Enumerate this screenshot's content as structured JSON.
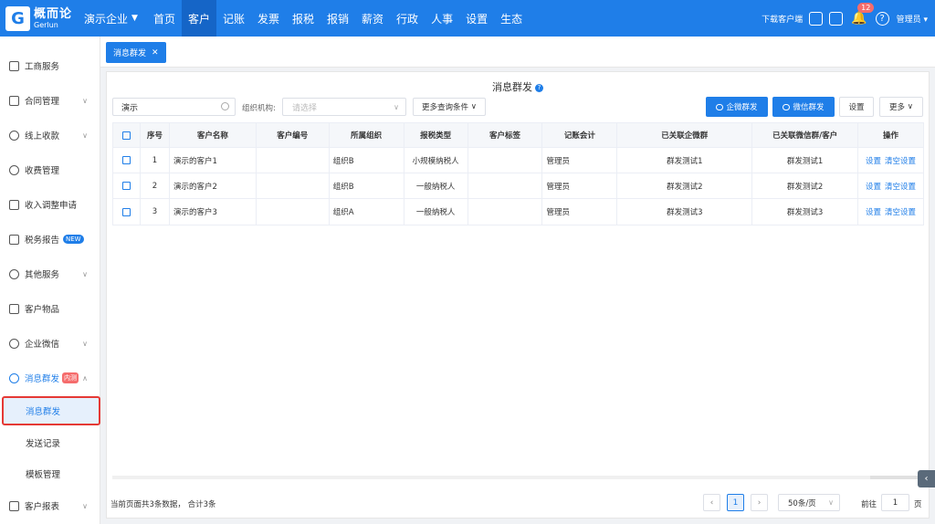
{
  "brand": {
    "cn": "概而论",
    "en": "Gerlun",
    "mark": "G"
  },
  "company": "演示企业",
  "nav": [
    "首页",
    "客户",
    "记账",
    "发票",
    "报税",
    "报销",
    "薪资",
    "行政",
    "人事",
    "设置",
    "生态"
  ],
  "nav_active": "客户",
  "top_right": {
    "download": "下载客户端",
    "badge_count": "12",
    "user": "管理员"
  },
  "sidebar": {
    "items": [
      {
        "label": "工商服务"
      },
      {
        "label": "合同管理"
      },
      {
        "label": "线上收款"
      },
      {
        "label": "收费管理"
      },
      {
        "label": "收入调整申请"
      },
      {
        "label": "税务报告",
        "badge": "NEW"
      },
      {
        "label": "其他服务"
      },
      {
        "label": "客户物品"
      },
      {
        "label": "企业微信"
      },
      {
        "label": "消息群发",
        "badge": "内测"
      }
    ],
    "sub_items": [
      {
        "label": "消息群发"
      },
      {
        "label": "发送记录"
      },
      {
        "label": "模板管理"
      }
    ],
    "last_item": {
      "label": "客户报表"
    }
  },
  "tab": {
    "label": "消息群发"
  },
  "page": {
    "title": "消息群发"
  },
  "filters": {
    "search_value": "演示",
    "org_label": "组织机构:",
    "org_placeholder": "请选择",
    "more_conditions": "更多查询条件"
  },
  "actions": {
    "enterprise_group_send": "企微群发",
    "wechat_group_send": "微信群发",
    "settings": "设置",
    "more": "更多"
  },
  "table": {
    "headers": [
      "序号",
      "客户名称",
      "客户编号",
      "所属组织",
      "报税类型",
      "客户标签",
      "记账会计",
      "已关联企微群",
      "已关联微信群/客户",
      "操作"
    ],
    "rows": [
      {
        "no": "1",
        "name": "演示的客户1",
        "code": "",
        "org": "组织B",
        "tax": "小规模纳税人",
        "tag": "",
        "accountant": "管理员",
        "wecom": "群发测试1",
        "wechat": "群发测试1"
      },
      {
        "no": "2",
        "name": "演示的客户2",
        "code": "",
        "org": "组织B",
        "tax": "一般纳税人",
        "tag": "",
        "accountant": "管理员",
        "wecom": "群发测试2",
        "wechat": "群发测试2"
      },
      {
        "no": "3",
        "name": "演示的客户3",
        "code": "",
        "org": "组织A",
        "tax": "一般纳税人",
        "tag": "",
        "accountant": "管理员",
        "wecom": "群发测试3",
        "wechat": "群发测试3"
      }
    ],
    "row_actions": {
      "set": "设置",
      "clear": "清空设置"
    }
  },
  "footer": {
    "info": "当前页面共3条数据， 合计3条",
    "current_page": "1",
    "page_size": "50条/页",
    "goto_label": "前往",
    "goto_value": "1",
    "page_unit": "页"
  }
}
